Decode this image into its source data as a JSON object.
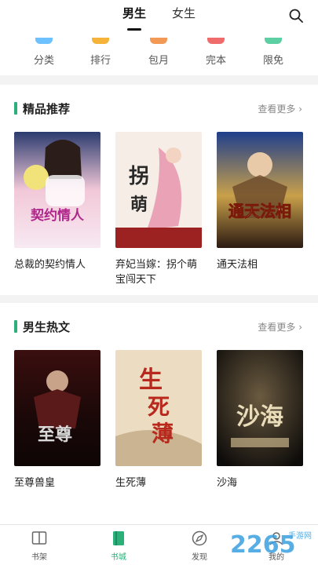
{
  "header": {
    "tabs": [
      {
        "label": "男生",
        "active": true
      },
      {
        "label": "女生",
        "active": false
      }
    ]
  },
  "quick_links": [
    {
      "label": "分类",
      "color": "#6ec1ff"
    },
    {
      "label": "排行",
      "color": "#f6b33a"
    },
    {
      "label": "包月",
      "color": "#f29a55"
    },
    {
      "label": "完本",
      "color": "#f06b6b"
    },
    {
      "label": "限免",
      "color": "#5cd0a2"
    }
  ],
  "sections": [
    {
      "title": "精品推荐",
      "more": "查看更多 ›",
      "books": [
        {
          "title": "总裁的契约情人",
          "cover_text": "总裁的契约情人"
        },
        {
          "title": "弃妃当嫁：拐个萌宝闯天下",
          "cover_text": "拐个萌宝闯天下"
        },
        {
          "title": "通天法相",
          "cover_text": "通天法相"
        }
      ]
    },
    {
      "title": "男生热文",
      "more": "查看更多 ›",
      "books": [
        {
          "title": "至尊兽皇",
          "cover_text": "至尊"
        },
        {
          "title": "生死薄",
          "cover_text": "生死薄"
        },
        {
          "title": "沙海",
          "cover_text": "沙海"
        }
      ]
    }
  ],
  "bottom_nav": [
    {
      "label": "书架",
      "active": false
    },
    {
      "label": "书城",
      "active": true
    },
    {
      "label": "发现",
      "active": false
    },
    {
      "label": "我的",
      "active": false
    }
  ],
  "watermark": {
    "text": "2265",
    "sub": "手游网"
  },
  "colors": {
    "accent": "#2bb07a"
  }
}
